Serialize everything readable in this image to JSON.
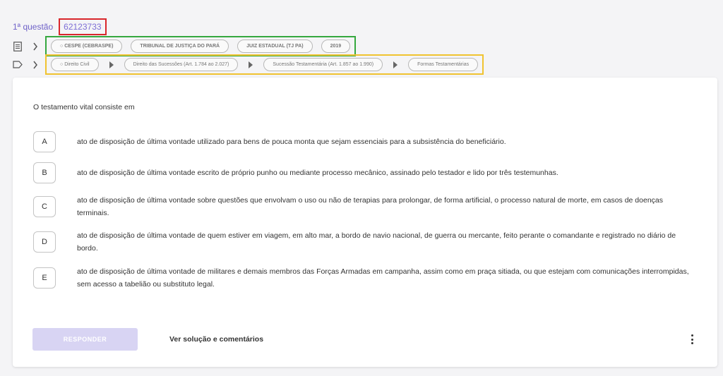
{
  "question": {
    "number_label": "1ª questão",
    "id": "62123733"
  },
  "info_tags": [
    "CESPE (CEBRASPE)",
    "TRIBUNAL DE JUSTIÇA DO PARÁ",
    "JUIZ ESTADUAL (TJ PA)",
    "2019"
  ],
  "subject_tags": [
    "Direito Civil",
    "Direito das Sucessões (Art. 1.784 ao 2.027)",
    "Sucessão Testamentária (Art. 1.857 ao 1.990)",
    "Formas Testamentárias"
  ],
  "statement": "O testamento vital consiste em",
  "options": [
    {
      "letter": "A",
      "text": "ato de disposição de última vontade utilizado para bens de pouca monta que sejam essenciais para a subsistência do beneficiário."
    },
    {
      "letter": "B",
      "text": "ato de disposição de última vontade escrito de próprio punho ou mediante processo mecânico, assinado pelo testador e lido por três testemunhas."
    },
    {
      "letter": "C",
      "text": "ato de disposição de última vontade sobre questões que envolvam o uso ou não de terapias para prolongar, de forma artificial, o processo natural de morte, em casos de doenças terminais."
    },
    {
      "letter": "D",
      "text": "ato de disposição de última vontade de quem estiver em viagem, em alto mar, a bordo de navio nacional, de guerra ou mercante, feito perante o comandante e registrado no diário de bordo."
    },
    {
      "letter": "E",
      "text": "ato de disposição de última vontade de militares e demais membros das Forças Armadas em campanha, assim como em praça sitiada, ou que estejam com comunicações interrompidas, sem acesso a tabelião ou substituto legal."
    }
  ],
  "actions": {
    "responder": "RESPONDER",
    "solucao": "Ver solução e comentários"
  },
  "colors": {
    "accent": "#6f62c8",
    "id_border": "#d9262b",
    "info_border": "#35a83f",
    "subject_border": "#f0c330",
    "button_disabled": "#d8d4f3"
  },
  "icons": {
    "info_row": "document-icon",
    "subject_row": "tag-icon",
    "more": "more-vertical-icon"
  }
}
